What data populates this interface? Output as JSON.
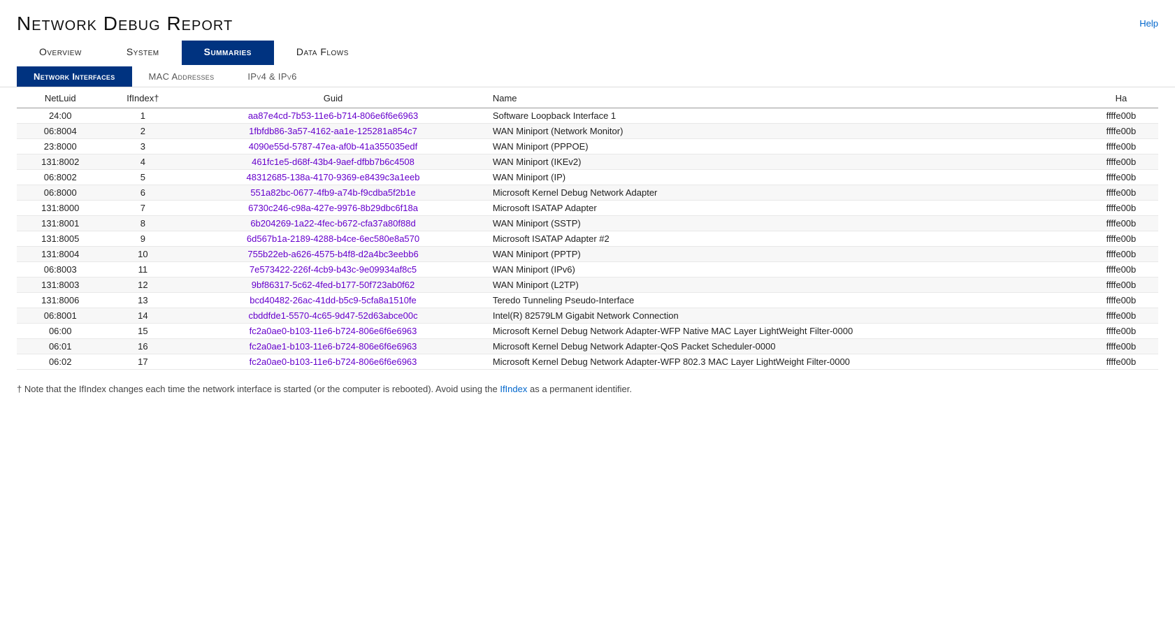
{
  "page": {
    "title": "Network Debug Report",
    "help_label": "Help"
  },
  "main_tabs": [
    {
      "label": "Overview",
      "active": false
    },
    {
      "label": "System",
      "active": false
    },
    {
      "label": "Summaries",
      "active": true
    },
    {
      "label": "Data Flows",
      "active": false
    }
  ],
  "sub_tabs": [
    {
      "label": "Network Interfaces",
      "active": true
    },
    {
      "label": "MAC Addresses",
      "active": false
    },
    {
      "label": "IPv4 & IPv6",
      "active": false
    }
  ],
  "table": {
    "columns": [
      "NetLuid",
      "IfIndex†",
      "Guid",
      "Name",
      "Ha"
    ],
    "rows": [
      {
        "netluid": "24:00",
        "ifindex": "1",
        "guid": "aa87e4cd-7b53-11e6-b714-806e6f6e6963",
        "name": "Software Loopback Interface 1",
        "ha": "ffffe00b"
      },
      {
        "netluid": "06:8004",
        "ifindex": "2",
        "guid": "1fbfdb86-3a57-4162-aa1e-125281a854c7",
        "name": "WAN Miniport (Network Monitor)",
        "ha": "ffffe00b"
      },
      {
        "netluid": "23:8000",
        "ifindex": "3",
        "guid": "4090e55d-5787-47ea-af0b-41a355035edf",
        "name": "WAN Miniport (PPPOE)",
        "ha": "ffffe00b"
      },
      {
        "netluid": "131:8002",
        "ifindex": "4",
        "guid": "461fc1e5-d68f-43b4-9aef-dfbb7b6c4508",
        "name": "WAN Miniport (IKEv2)",
        "ha": "ffffe00b"
      },
      {
        "netluid": "06:8002",
        "ifindex": "5",
        "guid": "48312685-138a-4170-9369-e8439c3a1eeb",
        "name": "WAN Miniport (IP)",
        "ha": "ffffe00b"
      },
      {
        "netluid": "06:8000",
        "ifindex": "6",
        "guid": "551a82bc-0677-4fb9-a74b-f9cdba5f2b1e",
        "name": "Microsoft Kernel Debug Network Adapter",
        "ha": "ffffe00b"
      },
      {
        "netluid": "131:8000",
        "ifindex": "7",
        "guid": "6730c246-c98a-427e-9976-8b29dbc6f18a",
        "name": "Microsoft ISATAP Adapter",
        "ha": "ffffe00b"
      },
      {
        "netluid": "131:8001",
        "ifindex": "8",
        "guid": "6b204269-1a22-4fec-b672-cfa37a80f88d",
        "name": "WAN Miniport (SSTP)",
        "ha": "ffffe00b"
      },
      {
        "netluid": "131:8005",
        "ifindex": "9",
        "guid": "6d567b1a-2189-4288-b4ce-6ec580e8a570",
        "name": "Microsoft ISATAP Adapter #2",
        "ha": "ffffe00b"
      },
      {
        "netluid": "131:8004",
        "ifindex": "10",
        "guid": "755b22eb-a626-4575-b4f8-d2a4bc3eebb6",
        "name": "WAN Miniport (PPTP)",
        "ha": "ffffe00b"
      },
      {
        "netluid": "06:8003",
        "ifindex": "11",
        "guid": "7e573422-226f-4cb9-b43c-9e09934af8c5",
        "name": "WAN Miniport (IPv6)",
        "ha": "ffffe00b"
      },
      {
        "netluid": "131:8003",
        "ifindex": "12",
        "guid": "9bf86317-5c62-4fed-b177-50f723ab0f62",
        "name": "WAN Miniport (L2TP)",
        "ha": "ffffe00b"
      },
      {
        "netluid": "131:8006",
        "ifindex": "13",
        "guid": "bcd40482-26ac-41dd-b5c9-5cfa8a1510fe",
        "name": "Teredo Tunneling Pseudo-Interface",
        "ha": "ffffe00b"
      },
      {
        "netluid": "06:8001",
        "ifindex": "14",
        "guid": "cbddfde1-5570-4c65-9d47-52d63abce00c",
        "name": "Intel(R) 82579LM Gigabit Network Connection",
        "ha": "ffffe00b"
      },
      {
        "netluid": "06:00",
        "ifindex": "15",
        "guid": "fc2a0ae0-b103-11e6-b724-806e6f6e6963",
        "name": "Microsoft Kernel Debug Network Adapter-WFP Native MAC Layer LightWeight Filter-0000",
        "ha": "ffffe00b"
      },
      {
        "netluid": "06:01",
        "ifindex": "16",
        "guid": "fc2a0ae1-b103-11e6-b724-806e6f6e6963",
        "name": "Microsoft Kernel Debug Network Adapter-QoS Packet Scheduler-0000",
        "ha": "ffffe00b"
      },
      {
        "netluid": "06:02",
        "ifindex": "17",
        "guid": "fc2a0ae0-b103-11e6-b724-806e6f6e6963",
        "name": "Microsoft Kernel Debug Network Adapter-WFP 802.3 MAC Layer LightWeight Filter-0000",
        "ha": "ffffe00b"
      }
    ]
  },
  "footnote": "† Note that the IfIndex changes each time the network interface is started (or the computer is rebooted). Avoid using the IfIndex as a permanent identifier."
}
